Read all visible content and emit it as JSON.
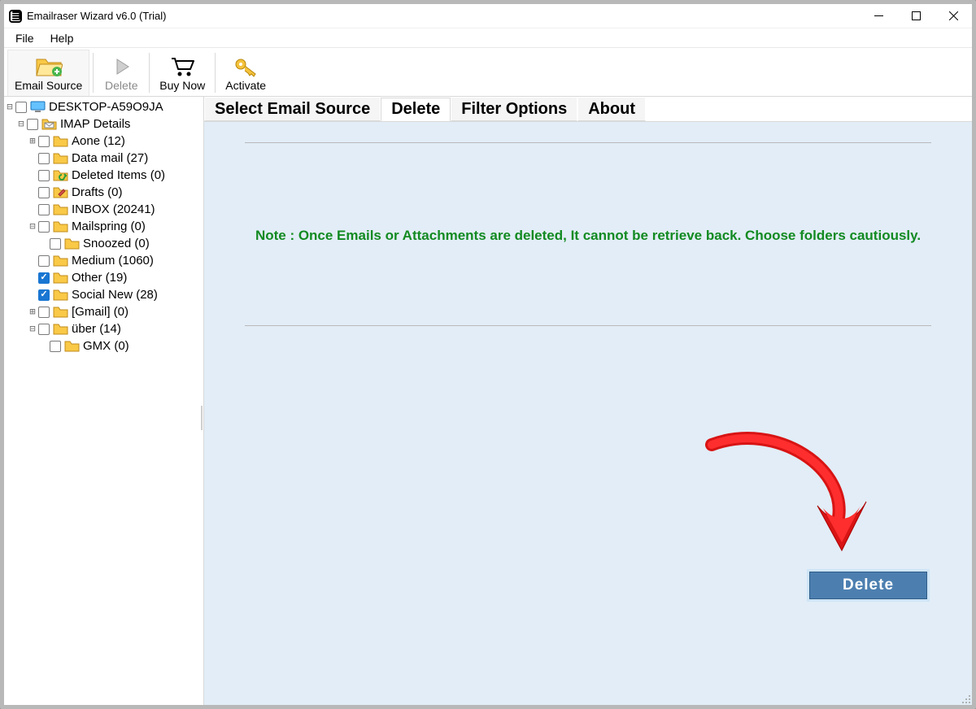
{
  "title": "Emailraser Wizard v6.0 (Trial)",
  "menu": {
    "file": "File",
    "help": "Help"
  },
  "toolbar": {
    "email_source": "Email Source",
    "delete": "Delete",
    "buy_now": "Buy Now",
    "activate": "Activate"
  },
  "tabs": {
    "select_source": "Select Email Source",
    "delete": "Delete",
    "filter_options": "Filter Options",
    "about": "About"
  },
  "pane": {
    "note": "Note : Once Emails or Attachments are deleted, It cannot be retrieve back. Choose folders cautiously.",
    "delete_btn": "Delete"
  },
  "tree": {
    "root": "DESKTOP-A59O9JA",
    "imap": "IMAP Details",
    "aone": "Aone (12)",
    "datamail": "Data mail (27)",
    "deleted": "Deleted Items (0)",
    "drafts": "Drafts (0)",
    "inbox": "INBOX (20241)",
    "mailspring": "Mailspring (0)",
    "snoozed": "Snoozed (0)",
    "medium": "Medium (1060)",
    "other": "Other (19)",
    "social": "Social New (28)",
    "gmail": "[Gmail] (0)",
    "uber": "über (14)",
    "gmx": "GMX (0)"
  }
}
